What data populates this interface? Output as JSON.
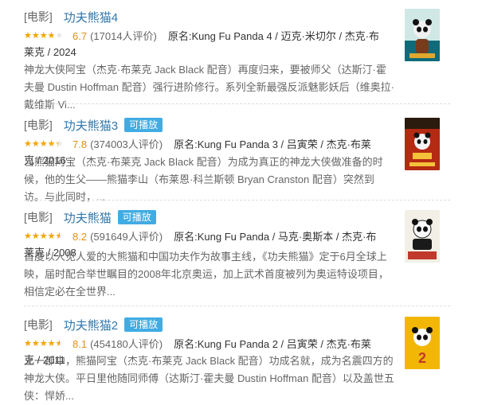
{
  "items": [
    {
      "category": "[电影]",
      "title": "功夫熊猫4",
      "playable": false,
      "badge": "",
      "rating_fraction": 0.67,
      "rating": "6.7",
      "votes": "(17014人评价)",
      "subject": "原名:Kung Fu Panda 4 / 迈克·米切尔 / 杰克·布莱克 / 2024",
      "desc": "神龙大侠阿宝（杰克·布莱克 Jack Black 配音）再度归来，要被师父（达斯汀·霍夫曼 Dustin Hoffman 配音）强行进阶修行。系列全新最强反派魅影妖后（维奥拉·戴维斯 Vi...",
      "poster_icon": "panda-poster-4",
      "poster_colors": [
        "#0f6b7a",
        "#f0f0f0",
        "#7a3a1c"
      ]
    },
    {
      "category": "[电影]",
      "title": "功夫熊猫3",
      "playable": true,
      "badge": "可播放",
      "rating_fraction": 0.78,
      "rating": "7.8",
      "votes": "(374003人评价)",
      "subject": "原名:Kung Fu Panda 3 / 吕寅荣 / 杰克·布莱克 / 2016",
      "desc": "当熊猫阿宝（杰克·布莱克 Jack Black 配音）为成为真正的神龙大侠做准备的时候，他的生父——熊猫李山（布莱恩·科兰斯顿 Bryan Cranston 配音）突然到访。与此同时，...",
      "poster_icon": "panda-poster-3",
      "poster_colors": [
        "#b42a12",
        "#f4c23a",
        "#2b1a0e"
      ]
    },
    {
      "category": "[电影]",
      "title": "功夫熊猫",
      "playable": true,
      "badge": "可播放",
      "rating_fraction": 0.82,
      "rating": "8.2",
      "votes": "(591649人评价)",
      "subject": "原名:Kung Fu Panda / 马克·奥斯本 / 杰克·布莱克 / 2008",
      "desc": "首度以人见人爱的大熊猫和中国功夫作为故事主线，《功夫熊猫》定于6月全球上映，届时配合举世瞩目的2008年北京奥运，加上武术首度被列为奥运特设项目，相信定必在全世界...",
      "poster_icon": "panda-poster-1",
      "poster_colors": [
        "#c0392b",
        "#f2f2f2",
        "#1a1a1a"
      ]
    },
    {
      "category": "[电影]",
      "title": "功夫熊猫2",
      "playable": true,
      "badge": "可播放",
      "rating_fraction": 0.81,
      "rating": "8.1",
      "votes": "(454180人评价)",
      "subject": "原名:Kung Fu Panda 2 / 吕寅荣 / 杰克·布莱克 / 2011",
      "desc": "上一部中，熊猫阿宝（杰克·布莱克 Jack Black 配音）功成名就，成为名震四方的神龙大侠。平日里他随同师傅（达斯汀·霍夫曼 Dustin Hoffman 配音）以及盖世五侠：悍娇...",
      "poster_icon": "panda-poster-2",
      "poster_colors": [
        "#f2b705",
        "#111111",
        "#ffffff"
      ]
    }
  ]
}
